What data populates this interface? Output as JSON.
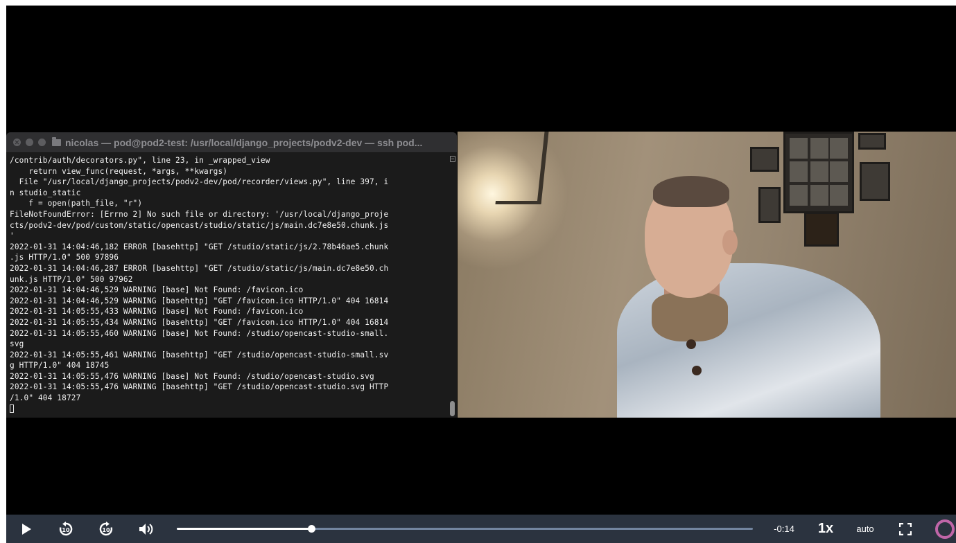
{
  "terminal": {
    "title": "nicolas — pod@pod2-test: /usr/local/django_projects/podv2-dev — ssh pod...",
    "lines": [
      "/contrib/auth/decorators.py\", line 23, in _wrapped_view",
      "    return view_func(request, *args, **kwargs)",
      "  File \"/usr/local/django_projects/podv2-dev/pod/recorder/views.py\", line 397, i",
      "n studio_static",
      "    f = open(path_file, \"r\")",
      "FileNotFoundError: [Errno 2] No such file or directory: '/usr/local/django_proje",
      "cts/podv2-dev/pod/custom/static/opencast/studio/static/js/main.dc7e8e50.chunk.js",
      "'",
      "2022-01-31 14:04:46,182 ERROR [basehttp] \"GET /studio/static/js/2.78b46ae5.chunk",
      ".js HTTP/1.0\" 500 97896",
      "2022-01-31 14:04:46,287 ERROR [basehttp] \"GET /studio/static/js/main.dc7e8e50.ch",
      "unk.js HTTP/1.0\" 500 97962",
      "2022-01-31 14:04:46,529 WARNING [base] Not Found: /favicon.ico",
      "2022-01-31 14:04:46,529 WARNING [basehttp] \"GET /favicon.ico HTTP/1.0\" 404 16814",
      "2022-01-31 14:05:55,433 WARNING [base] Not Found: /favicon.ico",
      "2022-01-31 14:05:55,434 WARNING [basehttp] \"GET /favicon.ico HTTP/1.0\" 404 16814",
      "2022-01-31 14:05:55,460 WARNING [base] Not Found: /studio/opencast-studio-small.",
      "svg",
      "2022-01-31 14:05:55,461 WARNING [basehttp] \"GET /studio/opencast-studio-small.sv",
      "g HTTP/1.0\" 404 18745",
      "2022-01-31 14:05:55,476 WARNING [base] Not Found: /studio/opencast-studio.svg",
      "2022-01-31 14:05:55,476 WARNING [basehttp] \"GET /studio/opencast-studio.svg HTTP",
      "/1.0\" 404 18727"
    ]
  },
  "player": {
    "time_remaining": "-0:14",
    "playback_rate": "1x",
    "quality": "auto",
    "progress_fraction": 0.233,
    "icons": {
      "play": "play-icon",
      "rewind": "replay-10-icon",
      "forward": "forward-10-icon",
      "volume": "volume-icon",
      "fullscreen": "fullscreen-icon",
      "logo": "pod-logo-icon"
    },
    "colors": {
      "control_bar": "#2b333f",
      "progress_track": "#73859f",
      "progress_fill": "#ffffff",
      "logo": "#c066a8"
    }
  }
}
